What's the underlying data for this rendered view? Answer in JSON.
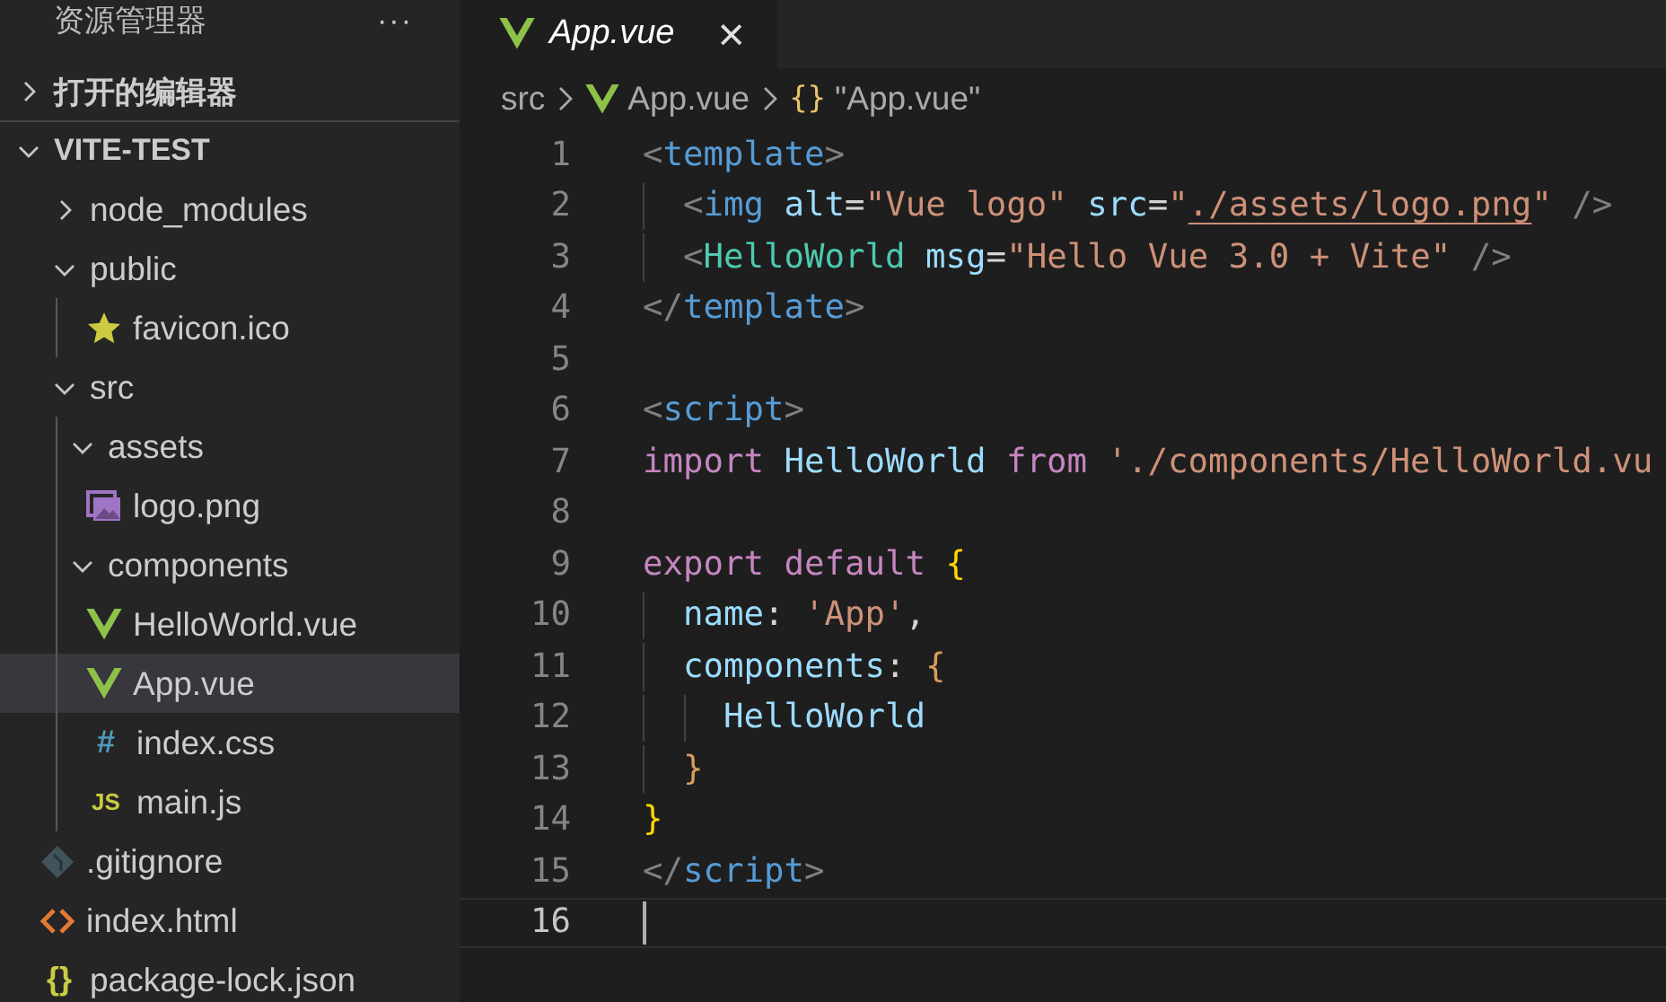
{
  "sidebar": {
    "title": "资源管理器",
    "more": "···",
    "sections": [
      {
        "label": "打开的编辑器",
        "expanded": false
      }
    ],
    "root": {
      "label": "VITE-TEST",
      "expanded": true,
      "children": [
        {
          "name": "node_modules",
          "kind": "folder",
          "expanded": false,
          "selected": false
        },
        {
          "name": "public",
          "kind": "folder",
          "expanded": true,
          "selected": false,
          "children": [
            {
              "name": "favicon.ico",
              "kind": "favicon",
              "selected": false
            }
          ]
        },
        {
          "name": "src",
          "kind": "folder",
          "expanded": true,
          "selected": false,
          "children": [
            {
              "name": "assets",
              "kind": "folder",
              "expanded": true,
              "selected": false,
              "children": [
                {
                  "name": "logo.png",
                  "kind": "image",
                  "selected": false
                }
              ]
            },
            {
              "name": "components",
              "kind": "folder",
              "expanded": true,
              "selected": false,
              "children": [
                {
                  "name": "HelloWorld.vue",
                  "kind": "vue",
                  "selected": false
                }
              ]
            },
            {
              "name": "App.vue",
              "kind": "vue",
              "selected": true
            },
            {
              "name": "index.css",
              "kind": "css",
              "glyph": "#",
              "selected": false
            },
            {
              "name": "main.js",
              "kind": "js",
              "glyph": "JS",
              "selected": false
            }
          ]
        },
        {
          "name": ".gitignore",
          "kind": "git",
          "selected": false
        },
        {
          "name": "index.html",
          "kind": "html",
          "selected": false
        },
        {
          "name": "package-lock.json",
          "kind": "json",
          "glyph": "{}",
          "selected": false
        }
      ]
    }
  },
  "tabs": [
    {
      "label": "App.vue",
      "kind": "vue",
      "selected": true,
      "preview": true,
      "close": "×"
    }
  ],
  "breadcrumb": [
    {
      "label": "src",
      "kind": "folder"
    },
    {
      "label": "App.vue",
      "kind": "vue"
    },
    {
      "label": "\"App.vue\"",
      "kind": "symbol",
      "glyph": "{}"
    }
  ],
  "editor": {
    "lines": [
      {
        "number": "1",
        "current": false,
        "tokens": [
          {
            "text": "<",
            "kind": "punct"
          },
          {
            "text": "template",
            "kind": "tag"
          },
          {
            "text": ">",
            "kind": "punct"
          }
        ],
        "children": [
          {
            "number": "2",
            "current": false,
            "tokens": [
              {
                "text": "<",
                "kind": "punct"
              },
              {
                "text": "img",
                "kind": "tag"
              },
              {
                "text": " alt",
                "kind": "attr"
              },
              {
                "text": "=",
                "kind": "plain"
              },
              {
                "text": "\"Vue logo\"",
                "kind": "string"
              },
              {
                "text": " src",
                "kind": "attr"
              },
              {
                "text": "=",
                "kind": "plain"
              },
              {
                "text": "\"",
                "kind": "string"
              },
              {
                "text": "./assets/logo.png",
                "kind": "link"
              },
              {
                "text": "\"",
                "kind": "string"
              },
              {
                "text": " />",
                "kind": "punct"
              }
            ]
          },
          {
            "number": "3",
            "current": false,
            "tokens": [
              {
                "text": "<",
                "kind": "punct"
              },
              {
                "text": "HelloWorld",
                "kind": "component"
              },
              {
                "text": " msg",
                "kind": "attr"
              },
              {
                "text": "=",
                "kind": "plain"
              },
              {
                "text": "\"Hello Vue 3.0 + Vite\"",
                "kind": "string"
              },
              {
                "text": " />",
                "kind": "punct"
              }
            ]
          }
        ]
      },
      {
        "number": "4",
        "current": false,
        "tokens": [
          {
            "text": "</",
            "kind": "punct"
          },
          {
            "text": "template",
            "kind": "tag"
          },
          {
            "text": ">",
            "kind": "punct"
          }
        ]
      },
      {
        "number": "5",
        "current": false
      },
      {
        "number": "6",
        "current": false,
        "tokens": [
          {
            "text": "<",
            "kind": "punct"
          },
          {
            "text": "script",
            "kind": "tag"
          },
          {
            "text": ">",
            "kind": "punct"
          }
        ]
      },
      {
        "number": "7",
        "current": false,
        "tokens": [
          {
            "text": "import",
            "kind": "keyword"
          },
          {
            "text": " HelloWorld",
            "kind": "variable"
          },
          {
            "text": " from",
            "kind": "keyword"
          },
          {
            "text": " './components/HelloWorld.vu",
            "kind": "string"
          }
        ]
      },
      {
        "number": "8",
        "current": false
      },
      {
        "number": "9",
        "current": false,
        "tokens": [
          {
            "text": "export",
            "kind": "keyword"
          },
          {
            "text": " default",
            "kind": "keyword"
          },
          {
            "text": " {",
            "kind": "brace1"
          }
        ],
        "children": [
          {
            "number": "10",
            "current": false,
            "tokens": [
              {
                "text": "name",
                "kind": "variable"
              },
              {
                "text": ":",
                "kind": "plain"
              },
              {
                "text": " 'App'",
                "kind": "string"
              },
              {
                "text": ",",
                "kind": "plain"
              }
            ]
          },
          {
            "number": "11",
            "current": false,
            "tokens": [
              {
                "text": "components",
                "kind": "variable"
              },
              {
                "text": ":",
                "kind": "plain"
              },
              {
                "text": " {",
                "kind": "brace2"
              }
            ],
            "children": [
              {
                "number": "12",
                "current": false,
                "tokens": [
                  {
                    "text": "HelloWorld",
                    "kind": "variable"
                  }
                ]
              }
            ]
          },
          {
            "number": "13",
            "current": false,
            "tokens": [
              {
                "text": "}",
                "kind": "brace2"
              }
            ]
          }
        ]
      },
      {
        "number": "14",
        "current": false,
        "tokens": [
          {
            "text": "}",
            "kind": "brace1"
          }
        ]
      },
      {
        "number": "15",
        "current": false,
        "tokens": [
          {
            "text": "</",
            "kind": "punct"
          },
          {
            "text": "script",
            "kind": "tag"
          },
          {
            "text": ">",
            "kind": "punct"
          }
        ]
      },
      {
        "number": "16",
        "current": true
      }
    ]
  }
}
